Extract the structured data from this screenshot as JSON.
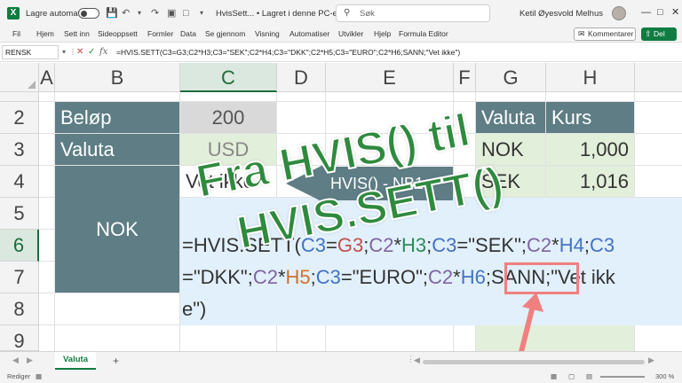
{
  "titlebar": {
    "autosave_label": "Lagre automatisk",
    "doc_title": "HvisSett... • Lagret i denne PC-en",
    "search_placeholder": "Søk",
    "user_name": "Ketil Øyesvold Melhus"
  },
  "ribbon": {
    "tabs": [
      "Fil",
      "Hjem",
      "Sett inn",
      "Sideoppsett",
      "Formler",
      "Data",
      "Se gjennom",
      "Visning",
      "Automatiser",
      "Utvikler",
      "Hjelp",
      "Formula Editor"
    ],
    "comments_label": "Kommentarer",
    "share_label": "Del"
  },
  "formula_bar": {
    "name_box": "RENSK",
    "formula": "=HVIS.SETT(C3=G3;C2*H3;C3=\"SEK\";C2*H4;C3=\"DKK\";C2*H5;C3=\"EURO\";C2*H6;SANN;\"Vet ikke\")"
  },
  "columns": [
    "A",
    "B",
    "C",
    "D",
    "E",
    "F",
    "G",
    "H"
  ],
  "rows": [
    "2",
    "3",
    "4",
    "5",
    "6",
    "7",
    "8",
    "9"
  ],
  "cells": {
    "b2": "Beløp",
    "c2": "200",
    "b3": "Valuta",
    "c3": "USD",
    "c4": "Vet ikke",
    "b_merged": "NOK",
    "g2": "Valuta",
    "h2": "Kurs",
    "g3": "NOK",
    "h3": "1,000",
    "g4": "SEK",
    "h4": "1,016"
  },
  "callout": "HVIS() - NB1",
  "headline": {
    "line1": "Fra HVIS() til",
    "line2": "HVIS.SETT()"
  },
  "formula_overlay": {
    "p1": "=HVIS.SETT(",
    "r1": "C3",
    "p2": "=",
    "r2": "G3",
    "p3": ";",
    "r3": "C2",
    "p4": "*",
    "r4": "H3",
    "p5": ";",
    "r5": "C3",
    "p6": "=\"SEK\";",
    "r6": "C2",
    "p7": "*",
    "r7": "H4",
    "p8": ";",
    "r8": "C3",
    "p9": "=\"DKK\";",
    "r9": "C2",
    "p10": "*",
    "r10": "H5",
    "p11": ";",
    "r11": "C3",
    "p12": "=\"EURO\";",
    "r12": "C2",
    "p13": "*",
    "r13": "H6",
    "p14": ";SANN;\"Vet ikke\")"
  },
  "sheet": {
    "tab_label": "Valuta"
  },
  "status": {
    "left": "Rediger",
    "zoom": "300 %"
  },
  "colors": {
    "excel_green": "#107c41",
    "teal_fill": "#5e7d85",
    "headline_green": "#2f8a3e",
    "highlight_pink": "#f08080"
  }
}
